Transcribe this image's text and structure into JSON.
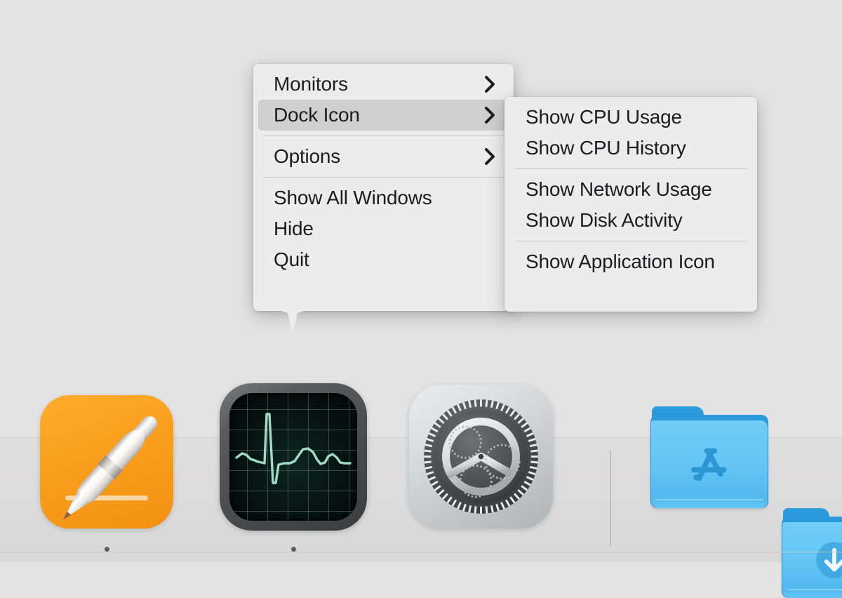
{
  "desktop": {
    "background_color": "#e4e3e3"
  },
  "context_menu": {
    "name": "Dock context menu",
    "app": "Activity Monitor",
    "items": [
      {
        "label": "Monitors",
        "has_submenu": true,
        "submenu_icon": "chevron-right-icon",
        "highlighted": false
      },
      {
        "label": "Dock Icon",
        "has_submenu": true,
        "submenu_icon": "chevron-right-icon",
        "highlighted": true
      },
      {
        "label": "Options",
        "has_submenu": true,
        "submenu_icon": "chevron-right-icon",
        "highlighted": false
      },
      {
        "label": "Show All Windows",
        "has_submenu": false,
        "submenu_icon": "",
        "highlighted": false
      },
      {
        "label": "Hide",
        "has_submenu": false,
        "submenu_icon": "",
        "highlighted": false
      },
      {
        "label": "Quit",
        "has_submenu": false,
        "submenu_icon": "",
        "highlighted": false
      }
    ],
    "highlight_color": "#cfcfcf",
    "background_color": "#ececec",
    "text_color": "#1d1d1f"
  },
  "submenu": {
    "name": "Dock Icon submenu",
    "items": [
      {
        "label": "Show CPU Usage"
      },
      {
        "label": "Show CPU History"
      },
      {
        "label": "Show Network Usage"
      },
      {
        "label": "Show Disk Activity"
      },
      {
        "label": "Show Application Icon"
      }
    ],
    "background_color": "#ececec"
  },
  "dock": {
    "background_color": "#dcdbdb",
    "separator_icon": "dock-separator",
    "tiles": [
      {
        "name": "pages",
        "label": "Pages",
        "icon": "pages-icon",
        "running": true
      },
      {
        "name": "activity-monitor",
        "label": "Activity Monitor",
        "icon": "activity-monitor-icon",
        "running": true
      },
      {
        "name": "system-preferences",
        "label": "System Preferences",
        "icon": "gear-icon",
        "running": false
      },
      {
        "name": "applications",
        "label": "Applications",
        "icon": "applications-folder-icon",
        "running": false
      },
      {
        "name": "downloads",
        "label": "Downloads",
        "icon": "downloads-folder-icon",
        "running": false
      }
    ]
  }
}
